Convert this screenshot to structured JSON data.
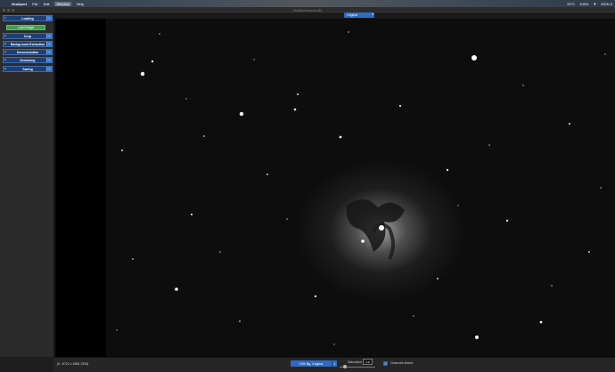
{
  "menubar": {
    "app_name": "GraXpert",
    "items": [
      "File",
      "Edit",
      "Window",
      "Help"
    ],
    "status": [
      "20°C",
      "100%",
      "▼",
      "MON 3"
    ]
  },
  "titlebar": {
    "title": "GraXpert-macos-x64"
  },
  "view": {
    "selected": "Original"
  },
  "sidebar": {
    "load_image_label": "Load Image",
    "panels": [
      {
        "num": "1",
        "label": "Loading"
      },
      {
        "num": "2",
        "label": "Crop"
      },
      {
        "num": "3",
        "label": "Background Extraction"
      },
      {
        "num": "4",
        "label": "Deconvolution"
      },
      {
        "num": "5",
        "label": "Denoising"
      },
      {
        "num": "6",
        "label": "Saving"
      }
    ],
    "toggle_symbol": "+"
  },
  "statusbar": {
    "coords": "(0 : 8722 x 4565 1928)",
    "stretch_label": "10% Bg, 3 sigma",
    "saturation_label": "Saturation",
    "saturation_value": "1.0",
    "saturation_fraction": 0.1,
    "channels_label": "Channels linked",
    "channels_linked": true
  },
  "colors": {
    "accent": "#2e6cc2",
    "panel": "#1e3f73",
    "load_button": "#3fa14e"
  }
}
